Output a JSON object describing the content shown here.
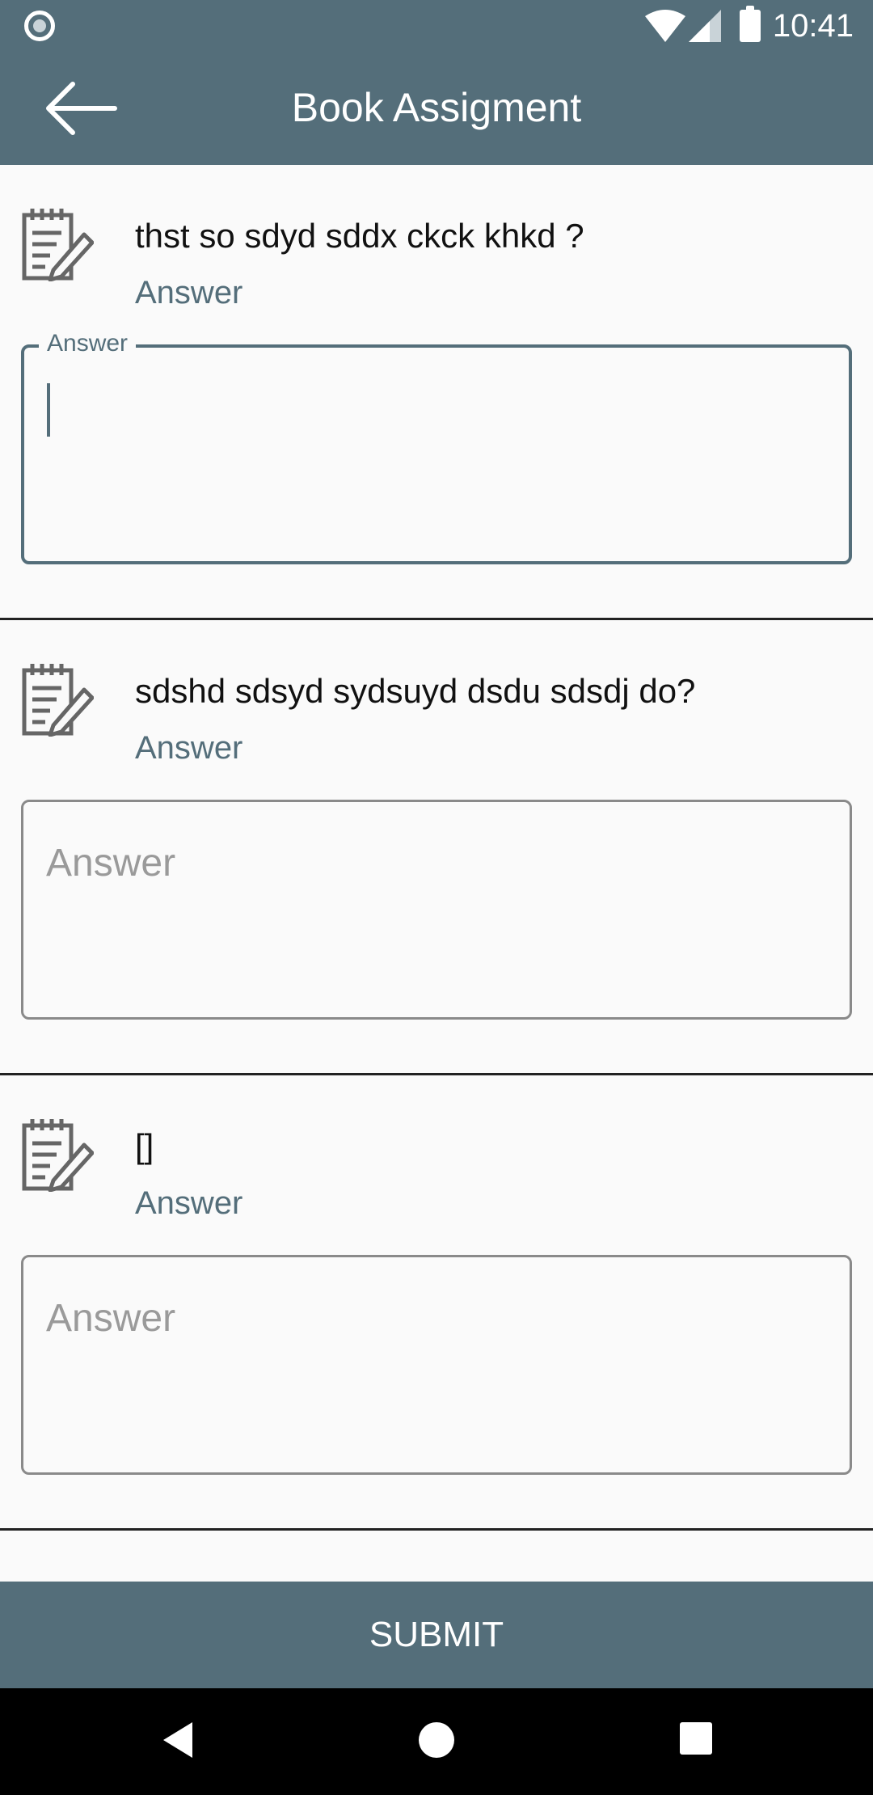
{
  "status_bar": {
    "time": "10:41"
  },
  "app_bar": {
    "title": "Book Assigment"
  },
  "questions": [
    {
      "question": "thst so sdyd sddx ckck khkd ?",
      "sub_label": "Answer",
      "field_label": "Answer",
      "placeholder": "",
      "value": ""
    },
    {
      "question": "sdshd sdsyd sydsuyd dsdu sdsdj do?",
      "sub_label": "Answer",
      "placeholder": "Answer",
      "value": ""
    },
    {
      "question": "[]",
      "sub_label": "Answer",
      "placeholder": "Answer",
      "value": ""
    }
  ],
  "submit_label": "SUBMIT",
  "colors": {
    "primary": "#546e7a",
    "background": "#fafafa"
  }
}
